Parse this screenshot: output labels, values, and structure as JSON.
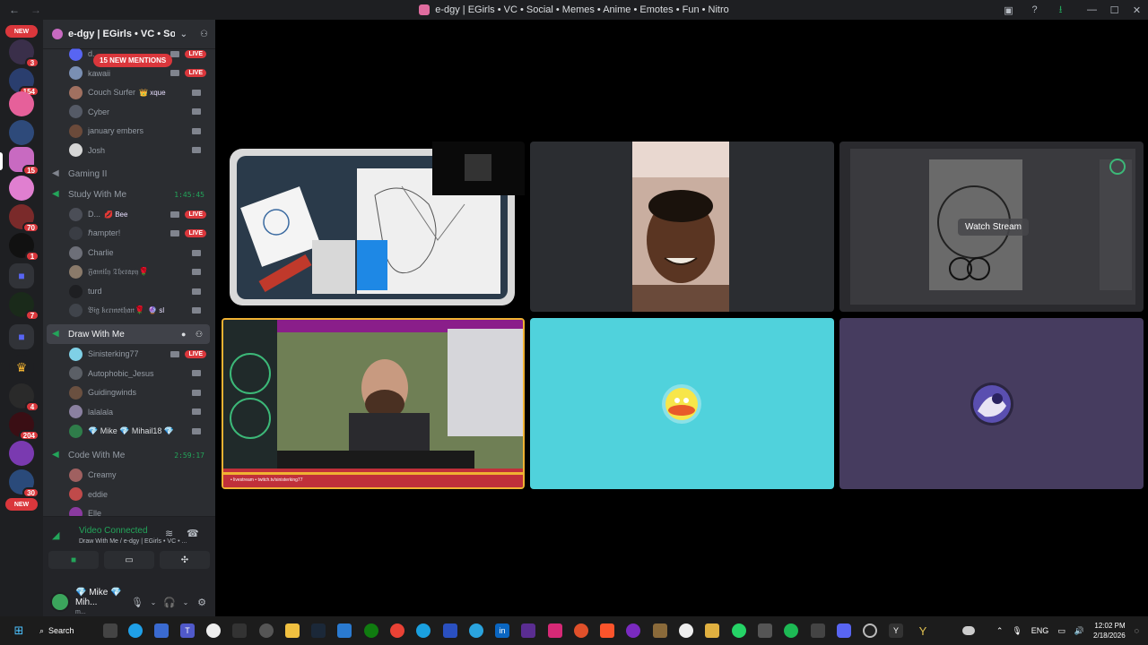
{
  "window": {
    "title": "e-dgy | EGirls • VC • Social • Memes • Anime • Emotes • Fun • Nitro",
    "nav_back": "←",
    "nav_fwd": "→"
  },
  "rail": {
    "new_top": "NEW",
    "new_bottom": "NEW",
    "badges": [
      "3",
      "154",
      "15",
      "70",
      "1",
      "7",
      "4",
      "204",
      "30"
    ]
  },
  "server": {
    "name": "e-dgy | EGirls • VC • So...",
    "new_mentions": "15 NEW MENTIONS"
  },
  "live_label": "LIVE",
  "top_members": [
    {
      "name": "d...",
      "live": true,
      "color": "#5865f2"
    },
    {
      "name": "kawaii",
      "live": true,
      "color": "#7a8fb3"
    },
    {
      "name": "Couch Surfer",
      "tag": "👑 xque",
      "live": false,
      "color": "#a07060"
    },
    {
      "name": "Cyber",
      "live": false,
      "color": "#555a66"
    },
    {
      "name": "january embers",
      "live": false,
      "color": "#6b4a3a"
    },
    {
      "name": "Josh",
      "live": false,
      "color": "#d6d6d6"
    }
  ],
  "channels": {
    "gaming": {
      "name": "Gaming II"
    },
    "study": {
      "name": "Study With Me",
      "time": "1:45:45"
    },
    "draw": {
      "name": "Draw With Me"
    },
    "code": {
      "name": "Code With Me",
      "time": "2:59:17"
    }
  },
  "study_members": [
    {
      "name": "D...",
      "tag": "💋 Bee",
      "live": true,
      "color": "#4b4e57"
    },
    {
      "name": "ℏampter!",
      "live": true,
      "color": "#3a3d44"
    },
    {
      "name": "Charlie",
      "live": false,
      "color": "#6d6f78"
    },
    {
      "name": "𝔉𝔞𝔪𝔦𝔩𝔶 𝔗𝔥𝔢𝔯𝔞𝔭𝔶🌹",
      "live": false,
      "color": "#8a7a6a"
    },
    {
      "name": "turd",
      "live": false,
      "color": "#1e1f22"
    },
    {
      "name": "𝔅𝔦𝔤 𝔨𝔢𝔯𝔪𝔬𝔱𝔥𝔞𝔫🌹",
      "tag": "🔮 sl",
      "live": false,
      "color": "#40444b"
    }
  ],
  "draw_members": [
    {
      "name": "Sinisterking77",
      "live": true,
      "color": "#7fd0e6"
    },
    {
      "name": "Autophobic_Jesus",
      "live": false,
      "color": "#5b5f66"
    },
    {
      "name": "Guidingwinds",
      "live": false,
      "color": "#6a5040"
    },
    {
      "name": "lalalala",
      "live": false,
      "color": "#8a80a0"
    },
    {
      "name": "💎 Mike 💎 Mihail18 💎",
      "live": false,
      "color": "#2f7d4a",
      "white": true
    }
  ],
  "code_members": [
    {
      "name": "Creamy",
      "color": "#a06060"
    },
    {
      "name": "eddie",
      "color": "#c04a4a"
    },
    {
      "name": "Elle",
      "color": "#8a3aa0"
    }
  ],
  "voice": {
    "status": "Video Connected",
    "location": "Draw With Me / e-dgy | EGirls • VC • ..."
  },
  "user": {
    "name": "💎 Mike 💎 Mih...",
    "sub": "m..."
  },
  "stage": {
    "watch_stream": "Watch Stream",
    "overlay_text": "• livestream • twitch.tv/sinisterking77"
  },
  "taskbar": {
    "search": "Search",
    "lang": "ENG",
    "time": "12:02 PM",
    "date": "2/18/2026"
  },
  "colors": {
    "tile_cyan": "#50d2dc",
    "tile_purple": "#463c5f",
    "live": "#da373c",
    "connected": "#23a55a"
  }
}
